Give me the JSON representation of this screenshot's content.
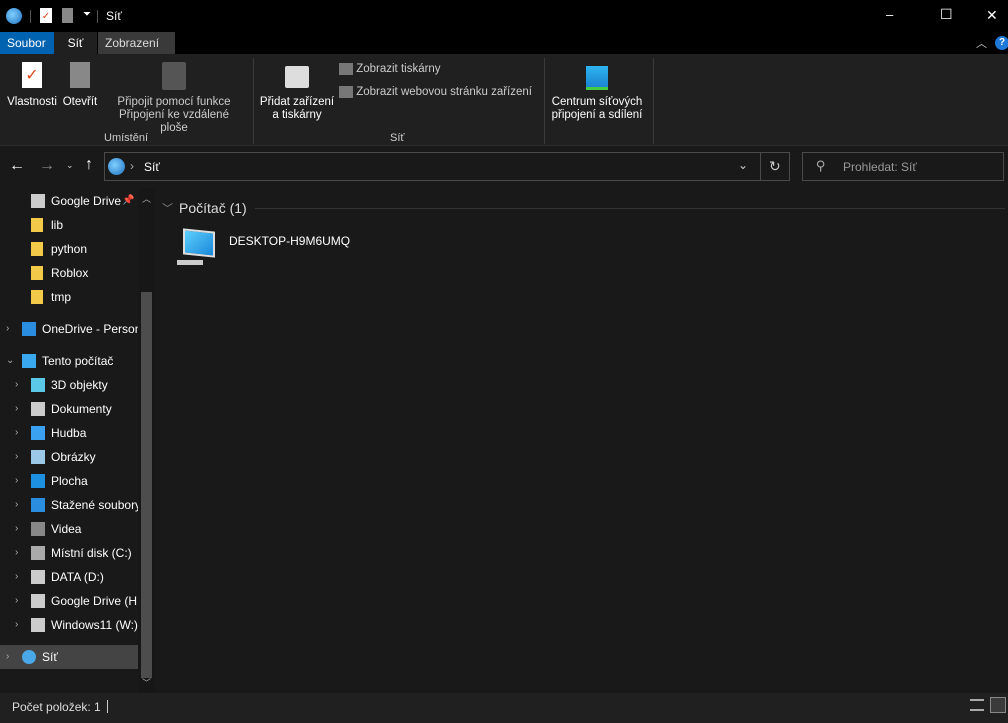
{
  "window": {
    "title": "Síť",
    "controls": {
      "minimize": "–",
      "maximize": "☐",
      "close": "✕"
    }
  },
  "ribbon_tabs": [
    {
      "label": "Soubor",
      "active_color": "#0063b1"
    },
    {
      "label": "Síť"
    },
    {
      "label": "Zobrazení"
    }
  ],
  "ribbon": {
    "buttons": {
      "properties": "Vlastnosti",
      "open": "Otevřít",
      "remote_1": "Připojit pomocí funkce",
      "remote_2": "Připojení ke vzdálené ploše",
      "add_1": "Přidat zařízení",
      "add_2": "a tiskárny",
      "show_printers": "Zobrazit tiskárny",
      "show_web": "Zobrazit webovou stránku zařízení",
      "center_1": "Centrum síťových",
      "center_2": "připojení a sdílení"
    },
    "groups": {
      "location": "Umístění",
      "network": "Síť"
    }
  },
  "address": {
    "path": "Síť",
    "search_placeholder": "Prohledat: Síť"
  },
  "nav": {
    "items": [
      {
        "label": "Google Drive",
        "icon": "drive-icon"
      },
      {
        "label": "lib",
        "icon": "folder-icon"
      },
      {
        "label": "python",
        "icon": "folder-icon"
      },
      {
        "label": "Roblox",
        "icon": "folder-icon"
      },
      {
        "label": "tmp",
        "icon": "folder-icon"
      },
      {
        "label": "OneDrive - Personal",
        "icon": "onedrive-icon"
      },
      {
        "label": "Tento počítač",
        "icon": "pc-icon"
      },
      {
        "label": "3D objekty",
        "icon": "3d-icon"
      },
      {
        "label": "Dokumenty",
        "icon": "documents-icon"
      },
      {
        "label": "Hudba",
        "icon": "music-icon"
      },
      {
        "label": "Obrázky",
        "icon": "pictures-icon"
      },
      {
        "label": "Plocha",
        "icon": "desktop-icon"
      },
      {
        "label": "Stažené soubory",
        "icon": "downloads-icon"
      },
      {
        "label": "Videa",
        "icon": "videos-icon"
      },
      {
        "label": "Místní disk (C:)",
        "icon": "disk-icon"
      },
      {
        "label": "DATA (D:)",
        "icon": "drive-icon"
      },
      {
        "label": "Google Drive (H:)",
        "icon": "drive-icon"
      },
      {
        "label": "Windows11 (W:)",
        "icon": "drive-icon"
      },
      {
        "label": "Síť",
        "icon": "network-icon"
      }
    ]
  },
  "content": {
    "group_label": "Počítač (1)",
    "items": [
      {
        "label": "DESKTOP-H9M6UMQ"
      }
    ]
  },
  "status": {
    "count": "Počet položek: 1"
  }
}
